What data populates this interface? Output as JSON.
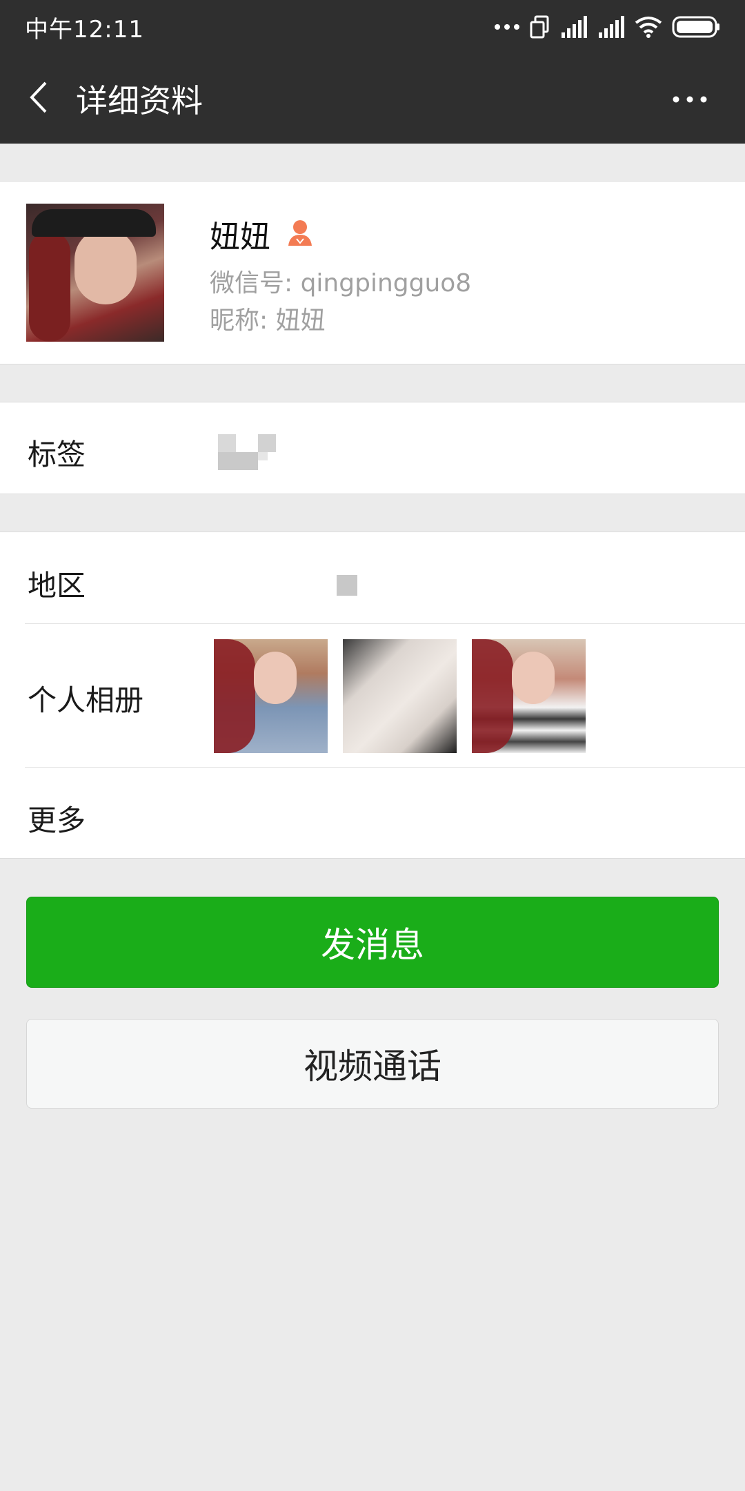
{
  "status_bar": {
    "time": "中午12:11",
    "icons": [
      "more-dots-icon",
      "sim-card-icon",
      "signal-icon",
      "signal-icon",
      "wifi-icon",
      "battery-icon"
    ]
  },
  "header": {
    "title": "详细资料",
    "back_icon": "back-arrow-icon",
    "more_icon": "more-icon"
  },
  "profile": {
    "name": "妞妞",
    "gender_icon": "female-icon",
    "gender_color": "#f37b53",
    "wechat_id": "微信号: qingpingguo8",
    "nickname": "昵称: 妞妞"
  },
  "tags": {
    "label": "标签"
  },
  "details": {
    "region_label": "地区",
    "album_label": "个人相册",
    "album_photos": 3,
    "more_label": "更多"
  },
  "actions": {
    "send_message": "发消息",
    "video_call": "视频通话",
    "send_color": "#1aad19"
  }
}
